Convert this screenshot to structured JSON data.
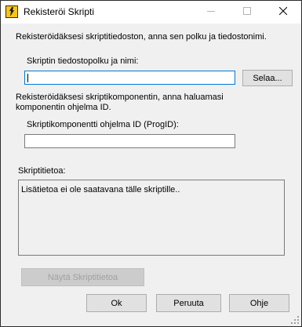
{
  "window": {
    "title": "Rekisteröi Skripti",
    "icon": "script-register-icon"
  },
  "controls": {
    "minimize": "minimize-icon",
    "maximize": "maximize-icon",
    "close": "close-icon"
  },
  "intro_text": "Rekisteröidäksesi skriptitiedoston, anna sen polku ja tiedostonimi.",
  "path": {
    "label": "Skriptin tiedostopolku ja nimi:",
    "value": "",
    "browse_label": "Selaa..."
  },
  "component": {
    "description_line1": "Rekisteröidäksesi skriptikomponentin, anna haluamasi",
    "description_line2": "komponentin ohjelma ID.",
    "progid_label": "Skriptikomponentti ohjelma ID (ProgID):",
    "progid_value": ""
  },
  "info": {
    "label": "Skriptitietoa:",
    "text": "Lisätietoa ei ole saatavana tälle skriptille.."
  },
  "buttons": {
    "show_info": "Näytä Skriptitietoa",
    "ok": "Ok",
    "cancel": "Peruuta",
    "help": "Ohje"
  },
  "colors": {
    "focus_border": "#0078d7",
    "dialog_bg": "#f0f0f0",
    "button_bg": "#e1e1e1"
  }
}
